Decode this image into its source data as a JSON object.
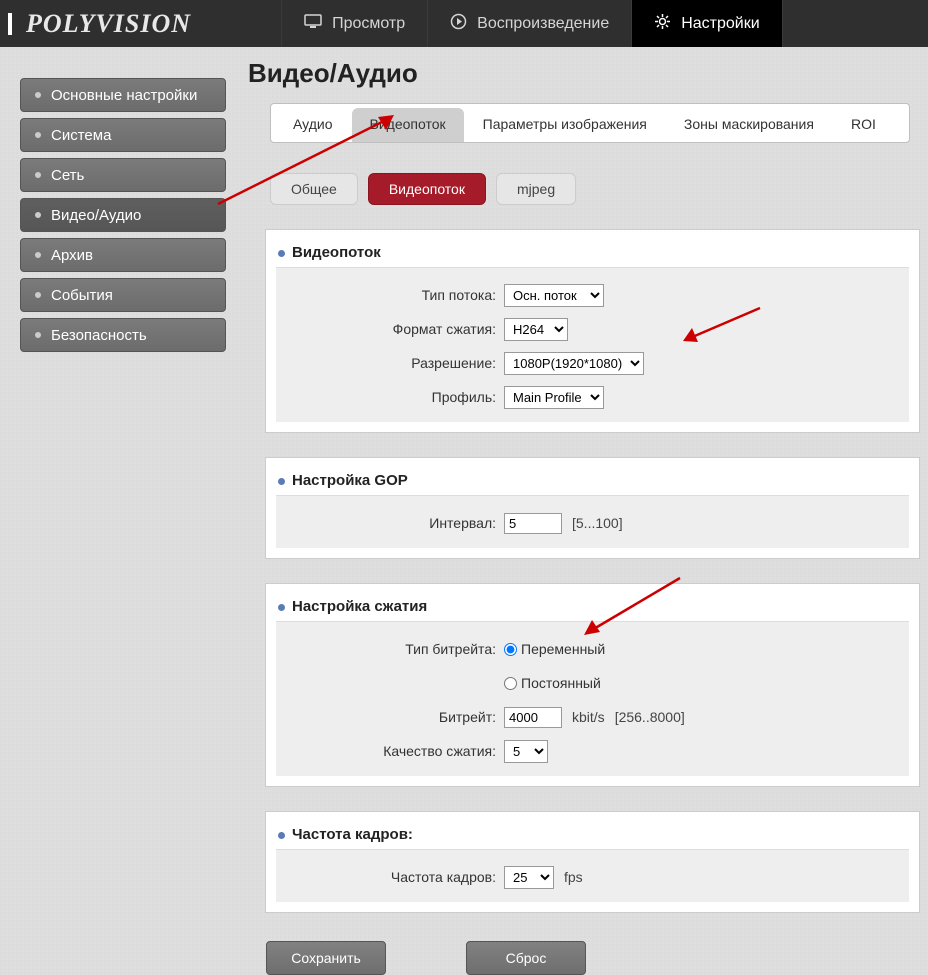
{
  "logo": "POLYVISION",
  "topnav": {
    "view": "Просмотр",
    "play": "Воспроизведение",
    "settings": "Настройки"
  },
  "sidebar": [
    "Основные настройки",
    "Система",
    "Сеть",
    "Видео/Аудио",
    "Архив",
    "События",
    "Безопасность"
  ],
  "title": "Видео/Аудио",
  "tabs": [
    "Аудио",
    "Видеопоток",
    "Параметры изображения",
    "Зоны маскирования",
    "ROI"
  ],
  "subtabs": [
    "Общее",
    "Видеопоток",
    "mjpeg"
  ],
  "section_stream": {
    "h": "Видеопоток",
    "type_lbl": "Тип потока:",
    "type_val": "Осн. поток",
    "fmt_lbl": "Формат сжатия:",
    "fmt_val": "H264",
    "res_lbl": "Разрешение:",
    "res_val": "1080P(1920*1080)",
    "prof_lbl": "Профиль:",
    "prof_val": "Main Profile"
  },
  "section_gop": {
    "h": "Настройка GOP",
    "int_lbl": "Интервал:",
    "int_val": "5",
    "int_hint": "[5...100]"
  },
  "section_comp": {
    "h": "Настройка сжатия",
    "btype_lbl": "Тип битрейта:",
    "btype_var": "Переменный",
    "btype_const": "Постоянный",
    "br_lbl": "Битрейт:",
    "br_val": "4000",
    "br_unit": "kbit/s",
    "br_hint": "[256..8000]",
    "q_lbl": "Качество сжатия:",
    "q_val": "5"
  },
  "section_fps": {
    "h": "Частота кадров:",
    "fps_lbl": "Частота кадров:",
    "fps_val": "25",
    "fps_unit": "fps"
  },
  "buttons": {
    "save": "Сохранить",
    "reset": "Сброс"
  }
}
